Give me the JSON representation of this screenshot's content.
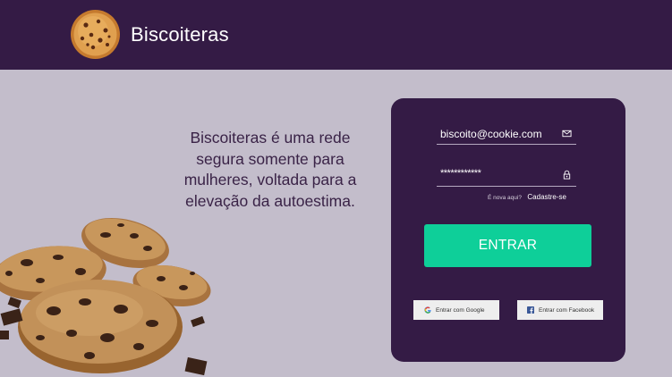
{
  "header": {
    "brand": "Biscoiteras",
    "logo_icon": "cookie-icon"
  },
  "main": {
    "tagline": "Biscoiteras é uma rede segura somente para mulheres, voltada para a elevação da autoestima."
  },
  "login": {
    "email_value": "biscoito@cookie.com",
    "email_icon": "mail-icon",
    "password_value": "************",
    "password_icon": "lock-icon",
    "signup_question": "É nova aqui?",
    "signup_link": "Cadastre-se",
    "enter_label": "ENTRAR",
    "google_label": "Entrar com Google",
    "facebook_label": "Entrar com Facebook"
  },
  "colors": {
    "background": "#c3bdcb",
    "header": "#341b45",
    "card": "#341b45",
    "accent": "#0ecf99",
    "facebook": "#3b5998"
  }
}
